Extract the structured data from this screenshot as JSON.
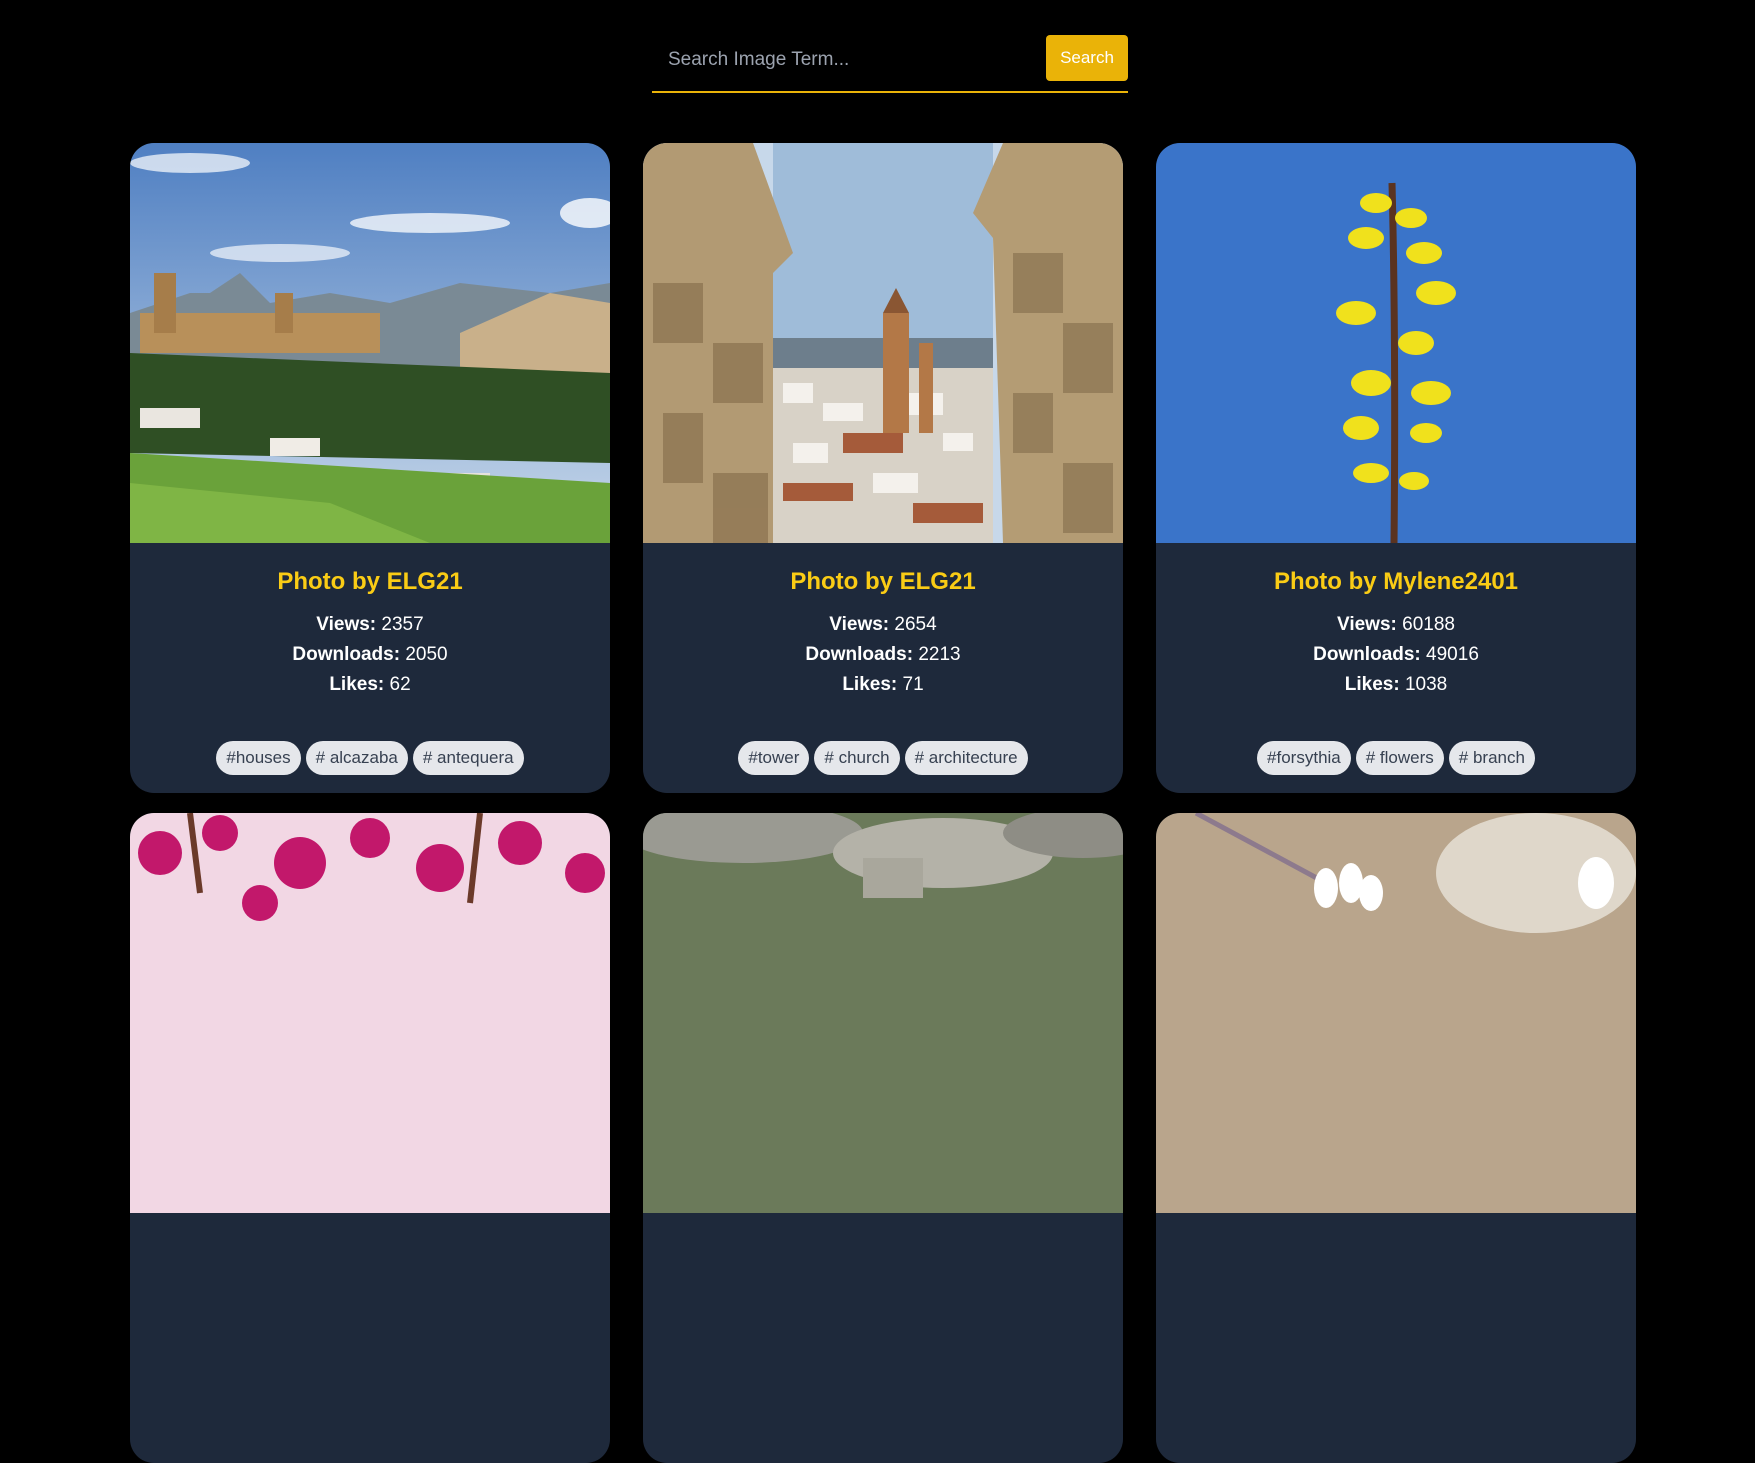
{
  "search": {
    "placeholder": "Search Image Term...",
    "button_label": "Search"
  },
  "cards": [
    {
      "title": "Photo by ELG21",
      "views_label": "Views:",
      "views": "2357",
      "downloads_label": "Downloads:",
      "downloads": "2050",
      "likes_label": "Likes:",
      "likes": "62",
      "tags": [
        "#houses",
        "# alcazaba",
        "# antequera"
      ]
    },
    {
      "title": "Photo by ELG21",
      "views_label": "Views:",
      "views": "2654",
      "downloads_label": "Downloads:",
      "downloads": "2213",
      "likes_label": "Likes:",
      "likes": "71",
      "tags": [
        "#tower",
        "# church",
        "# architecture"
      ]
    },
    {
      "title": "Photo by Mylene2401",
      "views_label": "Views:",
      "views": "60188",
      "downloads_label": "Downloads:",
      "downloads": "49016",
      "likes_label": "Likes:",
      "likes": "1038",
      "tags": [
        "#forsythia",
        "# flowers",
        "# branch"
      ]
    }
  ],
  "colors": {
    "accent": "#eab308",
    "title": "#facc15",
    "card_bg": "#1e293b",
    "page_bg": "#000000",
    "tag_bg": "#e5e7eb"
  }
}
